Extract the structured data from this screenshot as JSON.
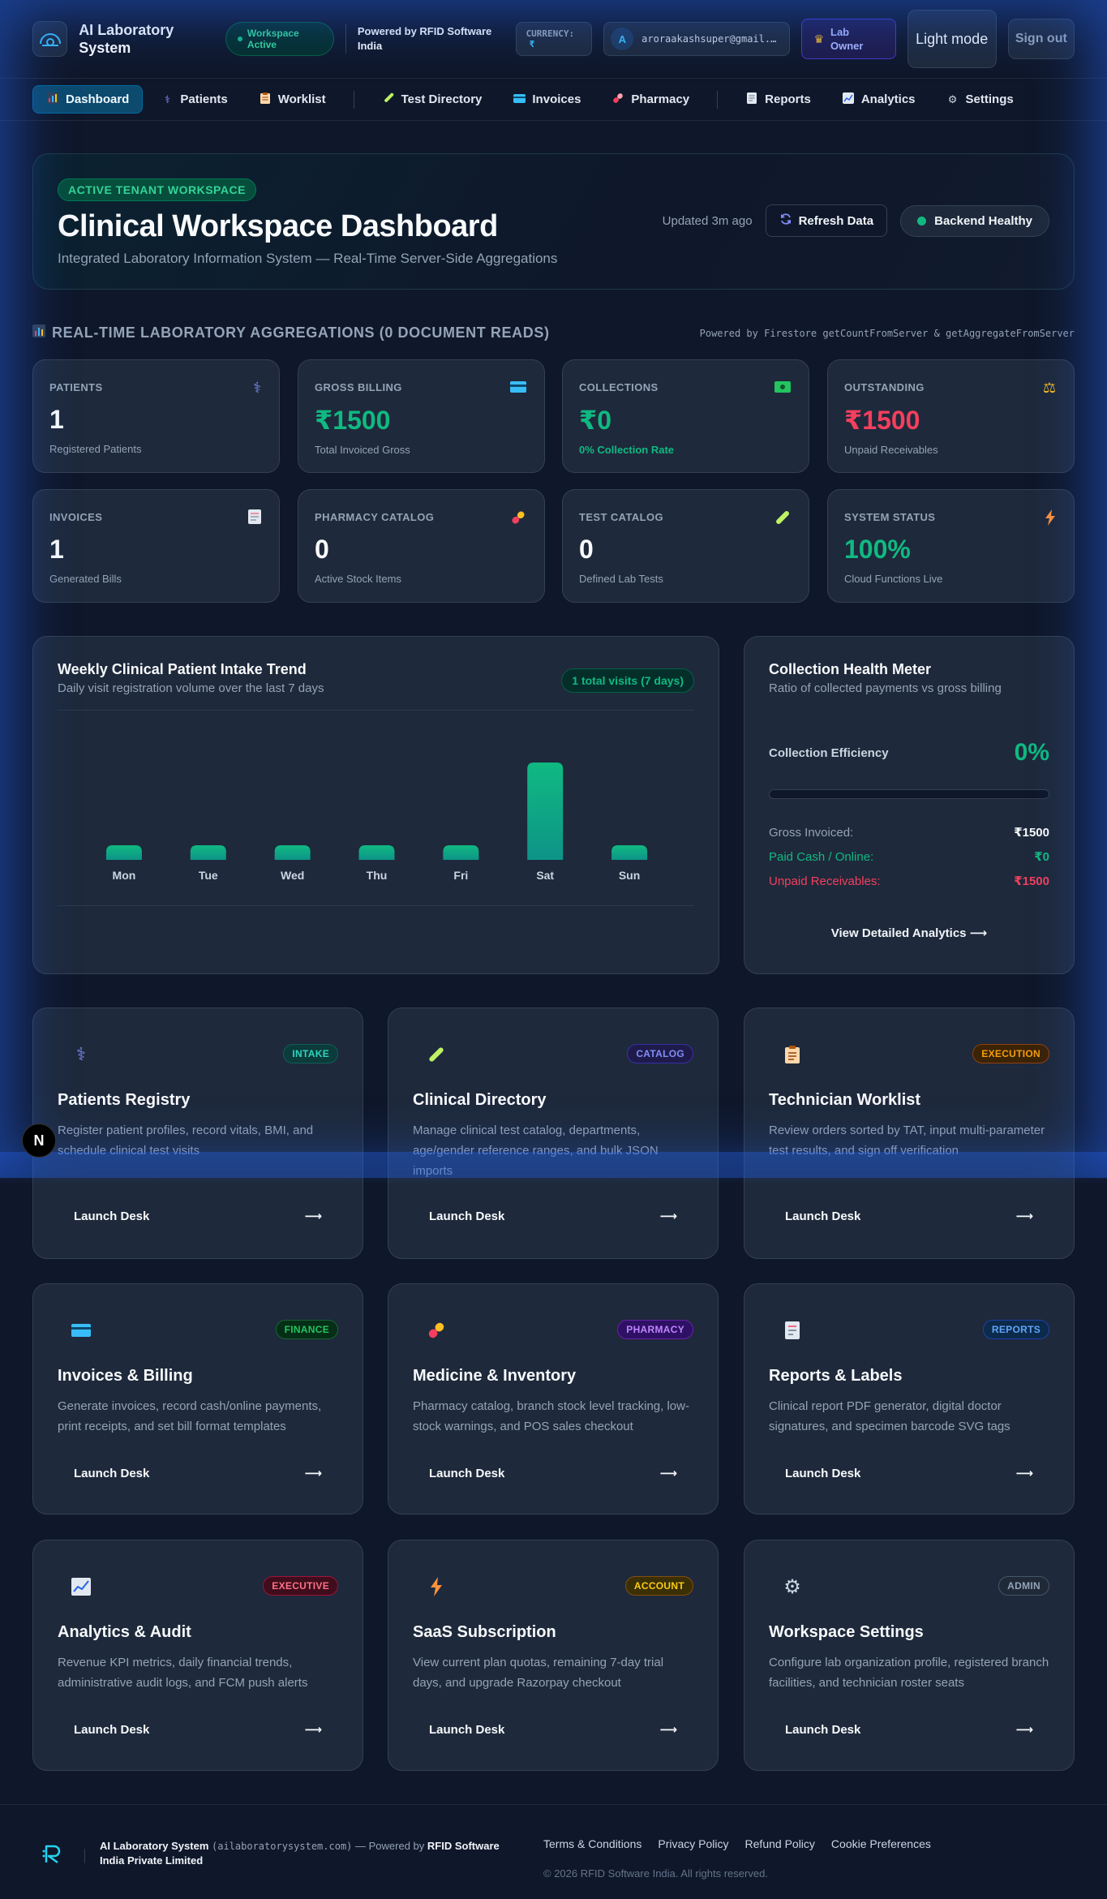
{
  "header": {
    "app_title": "AI Laboratory System",
    "workspace_badge": "Workspace Active",
    "powered_by": "Powered by RFID Software India",
    "currency_label": "CURRENCY:",
    "currency_symbol": "₹",
    "avatar_initial": "A",
    "user_email": "aroraakashsuper@gmail.com",
    "role": "Lab Owner",
    "theme_toggle": "Light mode",
    "signout": "Sign out"
  },
  "nav": {
    "items": [
      {
        "label": "Dashboard",
        "icon": "bar-chart-icon",
        "active": true
      },
      {
        "label": "Patients",
        "icon": "stethoscope-icon"
      },
      {
        "label": "Worklist",
        "icon": "clipboard-icon"
      },
      {
        "label": "Test Directory",
        "icon": "test-tube-icon"
      },
      {
        "label": "Invoices",
        "icon": "credit-card-icon"
      },
      {
        "label": "Pharmacy",
        "icon": "pill-icon"
      },
      {
        "label": "Reports",
        "icon": "document-icon"
      },
      {
        "label": "Analytics",
        "icon": "line-chart-icon"
      },
      {
        "label": "Settings",
        "icon": "gear-icon"
      }
    ]
  },
  "hero": {
    "tag": "ACTIVE TENANT WORKSPACE",
    "title": "Clinical Workspace Dashboard",
    "subtitle": "Integrated Laboratory Information System — Real-Time Server-Side Aggregations",
    "updated": "Updated 3m ago",
    "refresh_label": "Refresh Data",
    "health_label": "Backend Healthy"
  },
  "aggregations": {
    "title": "REAL-TIME LABORATORY AGGREGATIONS (0 DOCUMENT READS)",
    "note": "Powered by Firestore getCountFromServer & getAggregateFromServer",
    "stats": [
      {
        "label": "PATIENTS",
        "value": "1",
        "desc": "Registered Patients",
        "icon": "stethoscope-icon"
      },
      {
        "label": "GROSS BILLING",
        "value": "₹1500",
        "desc": "Total Invoiced Gross",
        "icon": "credit-card-icon"
      },
      {
        "label": "COLLECTIONS",
        "value": "₹0",
        "desc": "0% Collection Rate",
        "icon": "cash-icon"
      },
      {
        "label": "OUTSTANDING",
        "value": "₹1500",
        "desc": "Unpaid Receivables",
        "icon": "scales-icon"
      },
      {
        "label": "INVOICES",
        "value": "1",
        "desc": "Generated Bills",
        "icon": "receipt-icon"
      },
      {
        "label": "PHARMACY CATALOG",
        "value": "0",
        "desc": "Active Stock Items",
        "icon": "pill-icon"
      },
      {
        "label": "TEST CATALOG",
        "value": "0",
        "desc": "Defined Lab Tests",
        "icon": "test-tube-icon"
      },
      {
        "label": "SYSTEM STATUS",
        "value": "100%",
        "desc": "Cloud Functions Live",
        "icon": "lightning-icon"
      }
    ]
  },
  "trend": {
    "title": "Weekly Clinical Patient Intake Trend",
    "subtitle": "Daily visit registration volume over the last 7 days",
    "badge": "1 total visits (7 days)"
  },
  "chart_data": {
    "type": "bar",
    "categories": [
      "Mon",
      "Tue",
      "Wed",
      "Thu",
      "Fri",
      "Sat",
      "Sun"
    ],
    "values": [
      0,
      0,
      0,
      0,
      0,
      1,
      0
    ],
    "title": "Weekly Clinical Patient Intake Trend",
    "xlabel": "",
    "ylabel": "",
    "ylim": [
      0,
      1
    ],
    "grid": false,
    "bar_color": "#10b981"
  },
  "meter": {
    "title": "Collection Health Meter",
    "subtitle": "Ratio of collected payments vs gross billing",
    "efficiency_label": "Collection Efficiency",
    "efficiency_value": "0%",
    "efficiency_fraction": 0,
    "gross_label": "Gross Invoiced:",
    "gross_value": "₹1500",
    "paid_label": "Paid Cash / Online:",
    "paid_value": "₹0",
    "unpaid_label": "Unpaid Receivables:",
    "unpaid_value": "₹1500",
    "link": "View Detailed Analytics ⟶"
  },
  "modules": [
    {
      "title": "Patients Registry",
      "tag": "INTAKE",
      "icon": "stethoscope-icon",
      "desc": "Register patient profiles, record vitals, BMI, and schedule clinical test visits",
      "button": "Launch Desk"
    },
    {
      "title": "Clinical Directory",
      "tag": "CATALOG",
      "icon": "test-tube-icon",
      "desc": "Manage clinical test catalog, departments, age/gender reference ranges, and bulk JSON imports",
      "button": "Launch Desk"
    },
    {
      "title": "Technician Worklist",
      "tag": "EXECUTION",
      "icon": "clipboard-icon",
      "desc": "Review orders sorted by TAT, input multi-parameter test results, and sign off verification",
      "button": "Launch Desk"
    },
    {
      "title": "Invoices & Billing",
      "tag": "FINANCE",
      "icon": "credit-card-icon",
      "desc": "Generate invoices, record cash/online payments, print receipts, and set bill format templates",
      "button": "Launch Desk"
    },
    {
      "title": "Medicine & Inventory",
      "tag": "PHARMACY",
      "icon": "pill-icon",
      "desc": "Pharmacy catalog, branch stock level tracking, low-stock warnings, and POS sales checkout",
      "button": "Launch Desk"
    },
    {
      "title": "Reports & Labels",
      "tag": "REPORTS",
      "icon": "document-icon",
      "desc": "Clinical report PDF generator, digital doctor signatures, and specimen barcode SVG tags",
      "button": "Launch Desk"
    },
    {
      "title": "Analytics & Audit",
      "tag": "EXECUTIVE",
      "icon": "line-chart-icon",
      "desc": "Revenue KPI metrics, daily financial trends, administrative audit logs, and FCM push alerts",
      "button": "Launch Desk"
    },
    {
      "title": "SaaS Subscription",
      "tag": "ACCOUNT",
      "icon": "lightning-icon",
      "desc": "View current plan quotas, remaining 7-day trial days, and upgrade Razorpay checkout",
      "button": "Launch Desk"
    },
    {
      "title": "Workspace Settings",
      "tag": "ADMIN",
      "icon": "gear-icon",
      "desc": "Configure lab organization profile, registered branch facilities, and technician roster seats",
      "button": "Launch Desk"
    }
  ],
  "floating_badge": "N",
  "footer": {
    "brand": "AI Laboratory System",
    "domain": "(ailaboratorysystem.com)",
    "powered_prefix": "— Powered by",
    "company": "RFID Software India Private Limited",
    "links": [
      "Terms & Conditions",
      "Privacy Policy",
      "Refund Policy",
      "Cookie Preferences"
    ],
    "copyright": "© 2026 RFID Software India. All rights reserved."
  }
}
